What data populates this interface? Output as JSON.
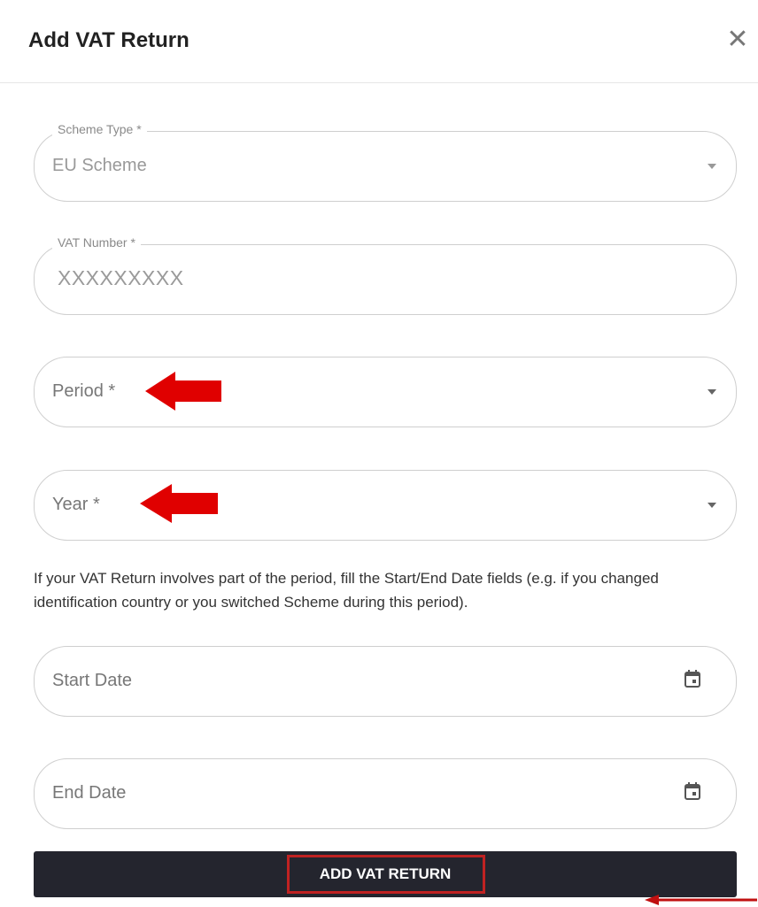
{
  "dialog": {
    "title": "Add VAT Return",
    "close_icon": "close-icon"
  },
  "form": {
    "scheme_type": {
      "label": "Scheme Type *",
      "value": "EU Scheme"
    },
    "vat_number": {
      "label": "VAT Number *",
      "value": "XXXXXXXXX"
    },
    "period": {
      "label": "Period *"
    },
    "year": {
      "label": "Year *"
    },
    "helper_text": "If your VAT Return involves part of the period, fill the Start/End Date fields (e.g. if you changed identification country or you switched Scheme during this period).",
    "start_date": {
      "label": "Start Date",
      "icon": "calendar-icon"
    },
    "end_date": {
      "label": "End Date",
      "icon": "calendar-icon"
    },
    "submit_label": "ADD VAT RETURN"
  },
  "colors": {
    "annotation_red": "#e00000",
    "button_bg": "#24252e"
  }
}
